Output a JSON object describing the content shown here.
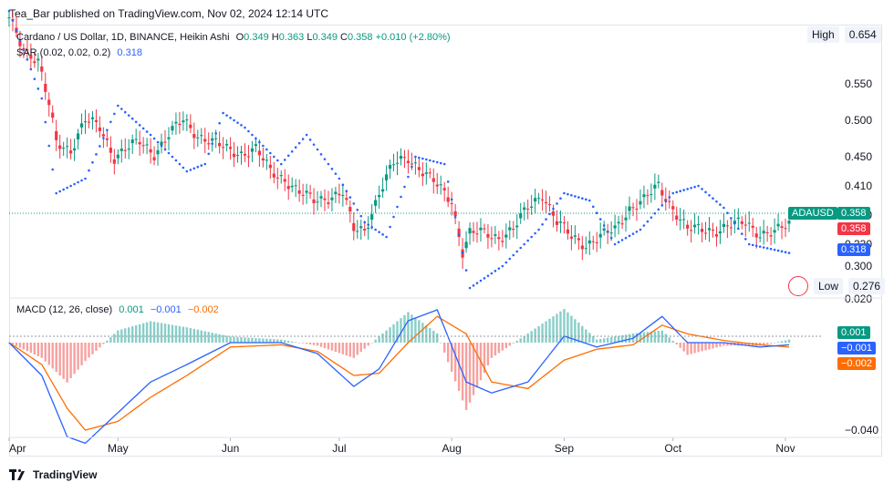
{
  "header": {
    "text": "Tea_Bar published on TradingView.com, Nov 02, 2024 12:14 UTC"
  },
  "legend": {
    "title": "Cardano / US Dollar, 1D, BINANCE, Heikin Ashi",
    "o_label": "O",
    "o": "0.349",
    "h_label": "H",
    "h": "0.363",
    "l_label": "L",
    "l": "0.349",
    "c_label": "C",
    "c": "0.358",
    "change": "+0.010 (+2.80%)",
    "sar_label": "SAR (0.02, 0.02, 0.2)",
    "sar_value": "0.318",
    "macd_label": "MACD (12, 26, close)",
    "macd_hist": "0.001",
    "macd_line": "−0.001",
    "macd_signal": "−0.002"
  },
  "price_axis": {
    "high_label": "High",
    "high_value": "0.654",
    "low_label": "Low",
    "low_value": "0.276",
    "symbol_tag": "ADAUSD",
    "last_price": "0.358",
    "open_tag": "0.358",
    "sar_tag": "0.318",
    "macd_tags": [
      "0.001",
      "−0.001",
      "−0.002"
    ]
  },
  "footer": {
    "brand": "TradingView"
  },
  "colors": {
    "up": "#089981",
    "down": "#f23645",
    "sar": "#2962ff",
    "macd": "#2962ff",
    "signal": "#ff6d00",
    "hist_up": "#26a69a",
    "hist_down": "#ef5350"
  },
  "chart_data": [
    {
      "type": "candlestick",
      "title": "Cardano / US Dollar, 1D, BINANCE, Heikin Ashi",
      "price_scale": "linear",
      "yticks": [
        0.3,
        0.33,
        0.37,
        0.41,
        0.45,
        0.5,
        0.55
      ],
      "ytick_labels": [
        "0.300",
        "0.330",
        "0.370",
        "0.410",
        "0.450",
        "0.500",
        "0.550"
      ],
      "x_tick_labels": [
        "Apr",
        "May",
        "Jun",
        "Jul",
        "Aug",
        "Sep",
        "Oct",
        "Nov"
      ],
      "x_tick_dates": [
        "2024-04-01",
        "2024-05-01",
        "2024-06-01",
        "2024-07-01",
        "2024-08-01",
        "2024-09-01",
        "2024-10-01",
        "2024-11-01"
      ],
      "date_range": [
        "2024-04-01",
        "2024-11-02"
      ],
      "close_series": {
        "dates": [
          "2024-04-01",
          "2024-04-05",
          "2024-04-09",
          "2024-04-12",
          "2024-04-14",
          "2024-04-18",
          "2024-04-22",
          "2024-04-26",
          "2024-04-30",
          "2024-05-03",
          "2024-05-07",
          "2024-05-11",
          "2024-05-15",
          "2024-05-19",
          "2024-05-23",
          "2024-05-27",
          "2024-05-31",
          "2024-06-04",
          "2024-06-08",
          "2024-06-12",
          "2024-06-16",
          "2024-06-20",
          "2024-06-24",
          "2024-06-28",
          "2024-07-02",
          "2024-07-05",
          "2024-07-08",
          "2024-07-12",
          "2024-07-16",
          "2024-07-20",
          "2024-07-24",
          "2024-07-28",
          "2024-08-01",
          "2024-08-04",
          "2024-08-06",
          "2024-08-10",
          "2024-08-14",
          "2024-08-18",
          "2024-08-22",
          "2024-08-26",
          "2024-08-30",
          "2024-09-03",
          "2024-09-07",
          "2024-09-11",
          "2024-09-15",
          "2024-09-19",
          "2024-09-23",
          "2024-09-27",
          "2024-10-01",
          "2024-10-05",
          "2024-10-09",
          "2024-10-13",
          "2024-10-17",
          "2024-10-21",
          "2024-10-25",
          "2024-10-29",
          "2024-11-02"
        ],
        "values": [
          0.64,
          0.6,
          0.58,
          0.52,
          0.47,
          0.46,
          0.5,
          0.49,
          0.45,
          0.46,
          0.47,
          0.455,
          0.48,
          0.5,
          0.48,
          0.47,
          0.46,
          0.455,
          0.46,
          0.43,
          0.42,
          0.4,
          0.39,
          0.395,
          0.4,
          0.35,
          0.35,
          0.4,
          0.44,
          0.45,
          0.43,
          0.41,
          0.39,
          0.32,
          0.345,
          0.345,
          0.34,
          0.35,
          0.38,
          0.4,
          0.36,
          0.34,
          0.33,
          0.34,
          0.35,
          0.38,
          0.39,
          0.41,
          0.38,
          0.35,
          0.35,
          0.35,
          0.355,
          0.36,
          0.345,
          0.345,
          0.358
        ]
      },
      "sar_series": {
        "dates": [
          "2024-04-01",
          "2024-04-10",
          "2024-04-14",
          "2024-04-22",
          "2024-05-01",
          "2024-05-10",
          "2024-05-20",
          "2024-05-25",
          "2024-05-30",
          "2024-06-05",
          "2024-06-15",
          "2024-06-22",
          "2024-07-01",
          "2024-07-08",
          "2024-07-14",
          "2024-07-22",
          "2024-07-30",
          "2024-08-06",
          "2024-08-15",
          "2024-08-25",
          "2024-09-01",
          "2024-09-08",
          "2024-09-15",
          "2024-09-22",
          "2024-10-01",
          "2024-10-08",
          "2024-10-15",
          "2024-10-22",
          "2024-11-02"
        ],
        "values": [
          0.65,
          0.53,
          0.4,
          0.42,
          0.52,
          0.48,
          0.43,
          0.44,
          0.51,
          0.49,
          0.44,
          0.48,
          0.42,
          0.36,
          0.34,
          0.45,
          0.44,
          0.27,
          0.3,
          0.35,
          0.4,
          0.39,
          0.33,
          0.35,
          0.4,
          0.41,
          0.38,
          0.33,
          0.318
        ]
      },
      "last_price": 0.358,
      "high": 0.654,
      "low": 0.276
    },
    {
      "type": "line",
      "title": "MACD (12, 26, close)",
      "yticks": [
        0.02,
        -0.04
      ],
      "ytick_labels": [
        "0.020",
        "−0.040"
      ],
      "series": [
        {
          "name": "MACD",
          "dates": [
            "2024-04-01",
            "2024-04-10",
            "2024-04-17",
            "2024-04-22",
            "2024-05-01",
            "2024-05-10",
            "2024-05-20",
            "2024-06-01",
            "2024-06-15",
            "2024-06-25",
            "2024-07-05",
            "2024-07-12",
            "2024-07-20",
            "2024-07-28",
            "2024-08-05",
            "2024-08-12",
            "2024-08-22",
            "2024-09-01",
            "2024-09-10",
            "2024-09-20",
            "2024-09-28",
            "2024-10-05",
            "2024-10-15",
            "2024-10-25",
            "2024-11-02"
          ],
          "values": [
            0.0,
            -0.015,
            -0.043,
            -0.046,
            -0.032,
            -0.018,
            -0.01,
            0.0,
            0.0,
            -0.005,
            -0.02,
            -0.012,
            0.01,
            0.015,
            -0.018,
            -0.023,
            -0.018,
            0.003,
            -0.002,
            0.002,
            0.012,
            0.0,
            0.0,
            -0.002,
            -0.001
          ]
        },
        {
          "name": "Signal",
          "dates": [
            "2024-04-01",
            "2024-04-10",
            "2024-04-17",
            "2024-04-22",
            "2024-05-01",
            "2024-05-10",
            "2024-05-20",
            "2024-06-01",
            "2024-06-15",
            "2024-06-25",
            "2024-07-05",
            "2024-07-12",
            "2024-07-20",
            "2024-07-28",
            "2024-08-05",
            "2024-08-12",
            "2024-08-22",
            "2024-09-01",
            "2024-09-10",
            "2024-09-20",
            "2024-09-28",
            "2024-10-05",
            "2024-10-15",
            "2024-10-25",
            "2024-11-02"
          ],
          "values": [
            0.0,
            -0.01,
            -0.03,
            -0.04,
            -0.036,
            -0.025,
            -0.015,
            -0.002,
            -0.001,
            -0.004,
            -0.015,
            -0.014,
            0.0,
            0.012,
            0.004,
            -0.018,
            -0.021,
            -0.008,
            -0.003,
            -0.001,
            0.008,
            0.004,
            0.001,
            -0.001,
            -0.002
          ]
        }
      ],
      "histogram_note": "bars = MACD − Signal"
    }
  ]
}
